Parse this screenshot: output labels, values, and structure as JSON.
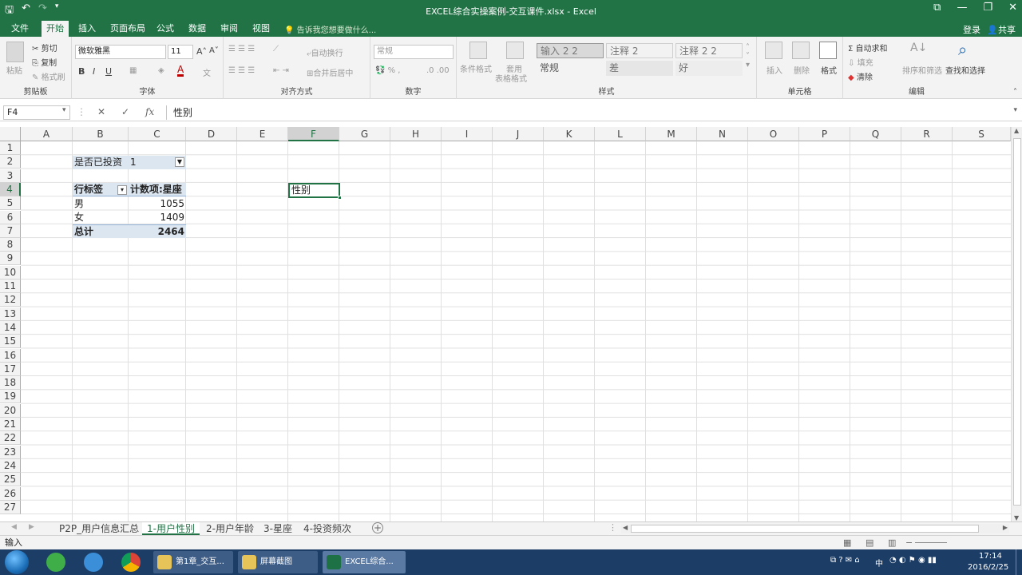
{
  "window": {
    "title": "EXCEL综合实操案例-交互课件.xlsx - Excel"
  },
  "tabs": [
    "文件",
    "开始",
    "插入",
    "页面布局",
    "公式",
    "数据",
    "审阅",
    "视图"
  ],
  "tellme": "告诉我您想要做什么...",
  "account": {
    "login": "登录",
    "share": "共享"
  },
  "ribbon": {
    "clipboard": {
      "paste": "粘贴",
      "cut": "剪切",
      "copy": "复制",
      "format_painter": "格式刷",
      "label": "剪贴板"
    },
    "font": {
      "name": "微软雅黑",
      "size": "11",
      "label": "字体"
    },
    "align": {
      "wrap": "自动换行",
      "merge": "合并后居中",
      "label": "对齐方式"
    },
    "number": {
      "format": "常规",
      "label": "数字"
    },
    "styles": {
      "cond": "条件格式",
      "table1": "套用",
      "table2": "表格格式",
      "s1": "输入 2 2",
      "s2": "注释 2",
      "s3": "注释 2 2",
      "s4": "常规",
      "s5": "差",
      "s6": "好",
      "label": "样式"
    },
    "cells": {
      "insert": "插入",
      "delete": "删除",
      "format": "格式",
      "label": "单元格"
    },
    "edit": {
      "autosum": "自动求和",
      "fill": "填充",
      "clear": "清除",
      "sort": "排序和筛选",
      "find": "查找和选择",
      "label": "编辑"
    }
  },
  "formula_bar": {
    "name_box": "F4",
    "content": "性别",
    "fx": "fx"
  },
  "columns": [
    "A",
    "B",
    "C",
    "D",
    "E",
    "F",
    "G",
    "H",
    "I",
    "J",
    "K",
    "L",
    "M",
    "N",
    "O",
    "P",
    "Q",
    "R",
    "S"
  ],
  "rows": [
    "1",
    "2",
    "3",
    "4",
    "5",
    "6",
    "7",
    "8",
    "9",
    "10",
    "11",
    "12",
    "13",
    "14",
    "15",
    "16",
    "17",
    "18",
    "19",
    "20",
    "21",
    "22",
    "23",
    "24",
    "25",
    "26",
    "27"
  ],
  "pivot": {
    "filter_label": "是否已投资",
    "filter_value": "1",
    "row_label": "行标签",
    "value_label": "计数项:星座",
    "rows": [
      {
        "label": "男",
        "value": "1055"
      },
      {
        "label": "女",
        "value": "1409"
      }
    ],
    "total_label": "总计",
    "total_value": "2464"
  },
  "active_cell_text": "性别",
  "sheets": [
    "P2P_用户信息汇总",
    "1-用户性别",
    "2-用户年龄",
    "3-星座",
    "4-投资频次"
  ],
  "status": {
    "mode": "输入"
  },
  "taskbar": {
    "items": [
      {
        "label": "第1章_交互..."
      },
      {
        "label": "屏幕截图"
      },
      {
        "label": "EXCEL综合..."
      }
    ],
    "time": "17:14",
    "date": "2016/2/25",
    "ime": "中"
  }
}
